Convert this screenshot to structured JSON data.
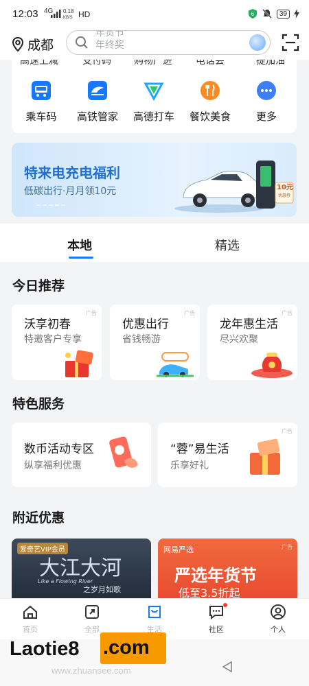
{
  "status_bar": {
    "time": "12:03",
    "network_type": "4G",
    "speed_value": "0.18",
    "speed_unit": "KB/S",
    "hd": "HD",
    "battery": "39"
  },
  "header": {
    "city": "成都",
    "search_hint_1": "年货节",
    "search_hint_2": "年终奖"
  },
  "cut_row": [
    "高速上减",
    "支付码",
    "购物广进",
    "电话会",
    "提加油"
  ],
  "services": [
    {
      "label": "乘车码",
      "icon": "bus-code-icon",
      "color": "#1677ff"
    },
    {
      "label": "高铁管家",
      "icon": "train-icon",
      "color": "#1677ff"
    },
    {
      "label": "高德打车",
      "icon": "amap-taxi-icon",
      "color": "#1aa7ff"
    },
    {
      "label": "餐饮美食",
      "icon": "dining-icon",
      "color": "#ff8a1f"
    },
    {
      "label": "更多",
      "icon": "more-icon",
      "color": "#3d7ff7"
    }
  ],
  "banner": {
    "title": "特来电充电福利",
    "subtitle": "低碳出行·月月领10元",
    "coupon": "10元",
    "coupon_note": "优惠券"
  },
  "tabs": [
    {
      "label": "本地"
    },
    {
      "label": "精选"
    }
  ],
  "today": {
    "title": "今日推荐",
    "ad_label": "广告",
    "cards": [
      {
        "title": "沃享初春",
        "subtitle": "特邀客户专享"
      },
      {
        "title": "优惠出行",
        "subtitle": "省钱畅游"
      },
      {
        "title": "龙年惠生活",
        "subtitle": "尽兴欢聚"
      }
    ]
  },
  "featured": {
    "title": "特色服务",
    "cards": [
      {
        "title": "数币活动专区",
        "subtitle": "纵享福利优惠"
      },
      {
        "title": "“蓉”易生活",
        "subtitle": "乐享好礼"
      }
    ]
  },
  "nearby": {
    "title": "附近优惠",
    "iqiyi": {
      "badge": "爱奇艺VIP会员",
      "title": "大江大河",
      "english": "Like a Flowing River",
      "subtitle": "之岁月如歌"
    },
    "yanxuan": {
      "brand": "网易严选",
      "title": "严选年货节",
      "subtitle": "低至3.5折起"
    }
  },
  "bottom_nav": [
    {
      "label": "首页",
      "icon": "home-icon"
    },
    {
      "label": "全部",
      "icon": "apps-icon"
    },
    {
      "label": "生活",
      "icon": "shopping-bag-icon"
    },
    {
      "label": "社区",
      "icon": "chat-icon"
    },
    {
      "label": "个人",
      "icon": "user-icon"
    }
  ],
  "watermark": {
    "text": "Laotie8",
    "com": ".com",
    "url": "www.zhuansee.com"
  }
}
